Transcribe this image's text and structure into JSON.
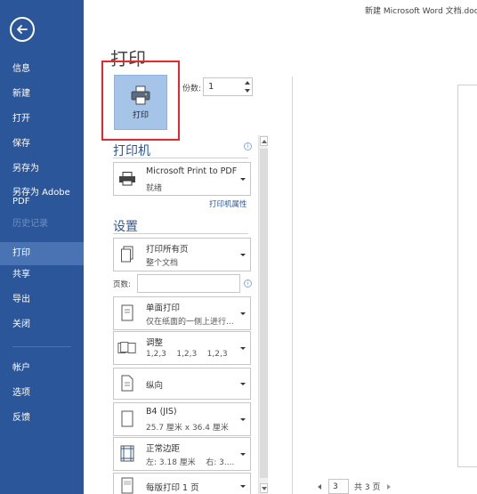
{
  "window": {
    "title": "新建 Microsoft Word 文档.docx"
  },
  "sidebar": {
    "items": [
      {
        "id": "info",
        "label": "信息",
        "state": "normal"
      },
      {
        "id": "new",
        "label": "新建",
        "state": "normal"
      },
      {
        "id": "open",
        "label": "打开",
        "state": "normal"
      },
      {
        "id": "save",
        "label": "保存",
        "state": "normal"
      },
      {
        "id": "save-as",
        "label": "另存为",
        "state": "normal"
      },
      {
        "id": "save-as-adobe",
        "label": "另存为 Adobe\nPDF",
        "state": "normal"
      },
      {
        "id": "history",
        "label": "历史记录",
        "state": "disabled"
      },
      {
        "id": "print",
        "label": "打印",
        "state": "active"
      },
      {
        "id": "share",
        "label": "共享",
        "state": "normal"
      },
      {
        "id": "export",
        "label": "导出",
        "state": "normal"
      },
      {
        "id": "close",
        "label": "关闭",
        "state": "normal"
      },
      {
        "id": "account",
        "label": "帐户",
        "state": "normal"
      },
      {
        "id": "options",
        "label": "选项",
        "state": "normal"
      },
      {
        "id": "feedback",
        "label": "反馈",
        "state": "normal"
      }
    ]
  },
  "print_panel": {
    "title": "打印",
    "print_button_label": "打印",
    "copies_label": "份数:",
    "copies_value": "1",
    "printer_heading": "打印机",
    "printer": {
      "name": "Microsoft Print to PDF",
      "status": "就绪"
    },
    "printer_properties_link": "打印机属性",
    "settings_heading": "设置",
    "settings": [
      {
        "id": "print-range",
        "main": "打印所有页",
        "sub": "整个文档",
        "icon": "pages-icon"
      },
      {
        "id": "sides",
        "main": "单面打印",
        "sub": "仅在纸面的一侧上进行...",
        "icon": "single-side-icon"
      },
      {
        "id": "collate",
        "main": "调整",
        "sub": "1,2,3    1,2,3    1,2,3",
        "icon": "collate-icon"
      },
      {
        "id": "orientation",
        "main": "纵向",
        "sub": "",
        "icon": "portrait-icon"
      },
      {
        "id": "paper-size",
        "main": "B4 (JIS)",
        "sub": "25.7 厘米 x 36.4 厘米",
        "icon": "paper-size-icon"
      },
      {
        "id": "margins",
        "main": "正常边距",
        "sub": "左: 3.18 厘米    右: 3....",
        "icon": "margins-icon"
      },
      {
        "id": "pages-per-sheet",
        "main": "每版打印 1 页",
        "sub": "",
        "icon": "pages-per-sheet-icon"
      }
    ],
    "pages_label": "页数:",
    "pages_value": ""
  },
  "preview": {
    "current_page": "3",
    "total_label": "共 3 页"
  },
  "colors": {
    "sidebar": "#2b579a",
    "accent": "#2b579a",
    "highlight": "#e8262b",
    "print_button": "#a6c3e8"
  }
}
